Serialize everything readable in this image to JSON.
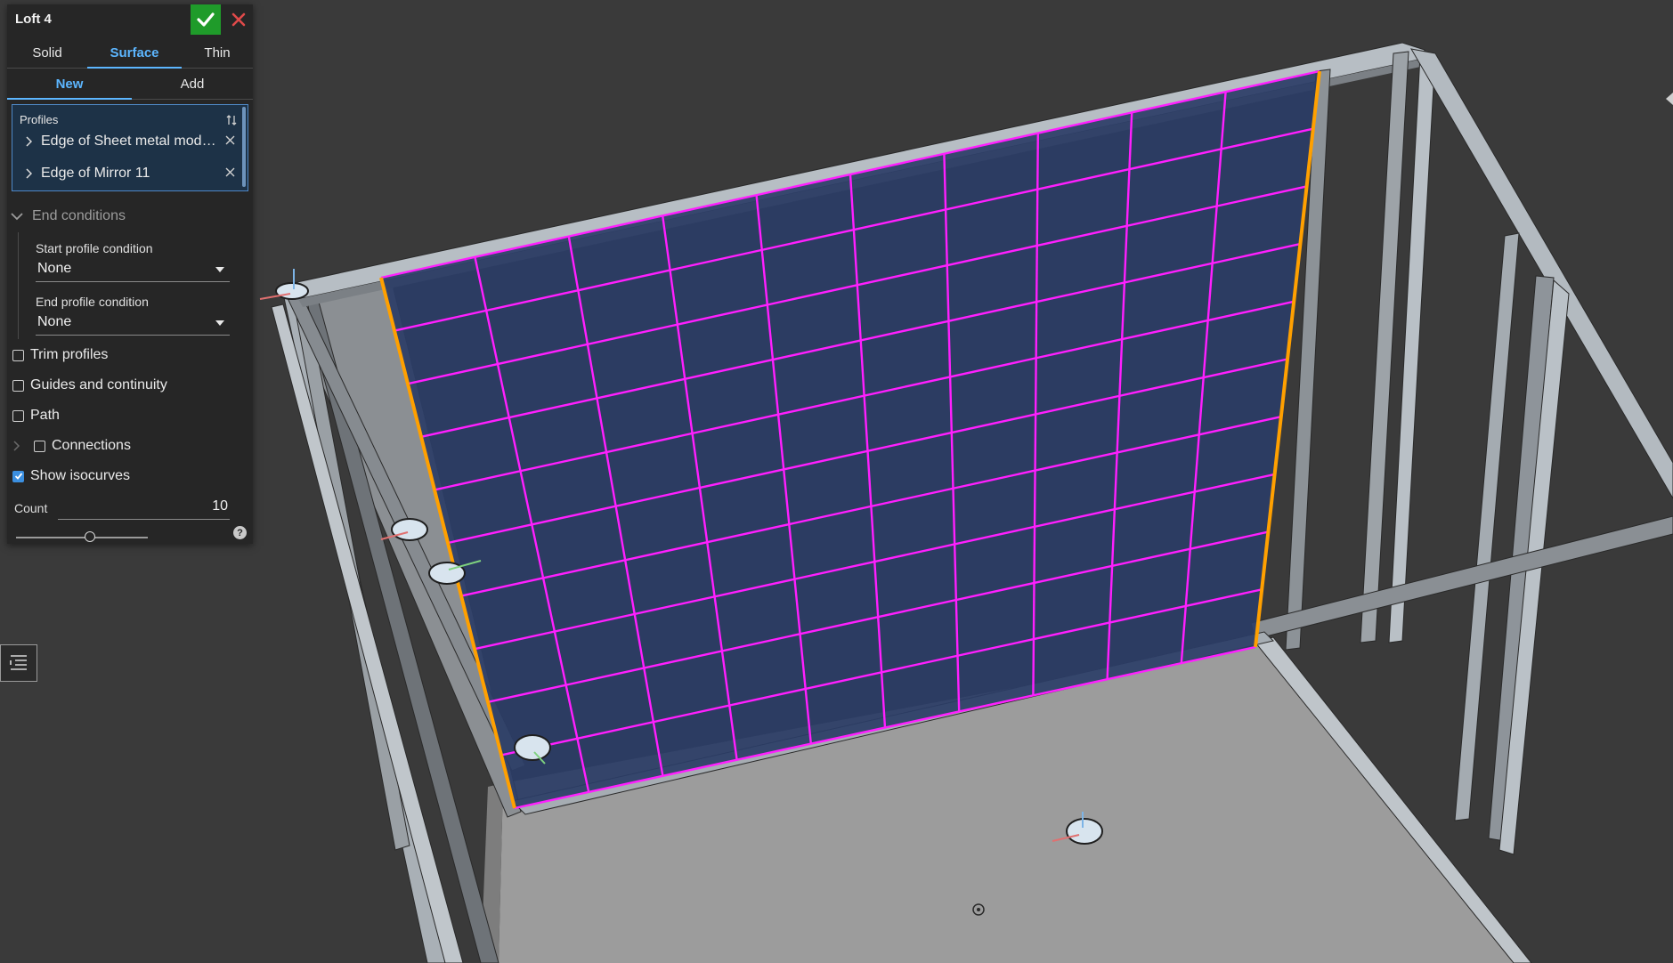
{
  "dialog": {
    "title": "Loft 4",
    "type_tabs": [
      {
        "label": "Solid",
        "active": false
      },
      {
        "label": "Surface",
        "active": true
      },
      {
        "label": "Thin",
        "active": false
      }
    ],
    "op_tabs": [
      {
        "label": "New",
        "active": true
      },
      {
        "label": "Add",
        "active": false
      }
    ],
    "profiles": {
      "label": "Profiles",
      "items": [
        {
          "label": "Edge of Sheet metal mode..."
        },
        {
          "label": "Edge of Mirror 11"
        }
      ]
    },
    "end_conditions": {
      "label": "End conditions",
      "start_label": "Start profile condition",
      "start_value": "None",
      "end_label": "End profile condition",
      "end_value": "None"
    },
    "checkboxes": {
      "trim_profiles": {
        "label": "Trim profiles",
        "checked": false
      },
      "guides": {
        "label": "Guides and continuity",
        "checked": false
      },
      "path": {
        "label": "Path",
        "checked": false
      },
      "connections": {
        "label": "Connections",
        "checked": false
      },
      "show_isocurves": {
        "label": "Show isocurves",
        "checked": true
      }
    },
    "count": {
      "label": "Count",
      "value": "10",
      "slider_fraction": 0.56
    },
    "help": "?"
  },
  "icons": {
    "confirm": "checkmark-icon",
    "cancel": "close-icon",
    "sort": "sort-icon",
    "list": "feature-list-icon"
  },
  "colors": {
    "surface": "#2b3d66",
    "isocurve": "#ff1fff",
    "profile_edge": "#ffa000",
    "confirm": "#1f9b2a",
    "accent": "#5cb6ff"
  }
}
